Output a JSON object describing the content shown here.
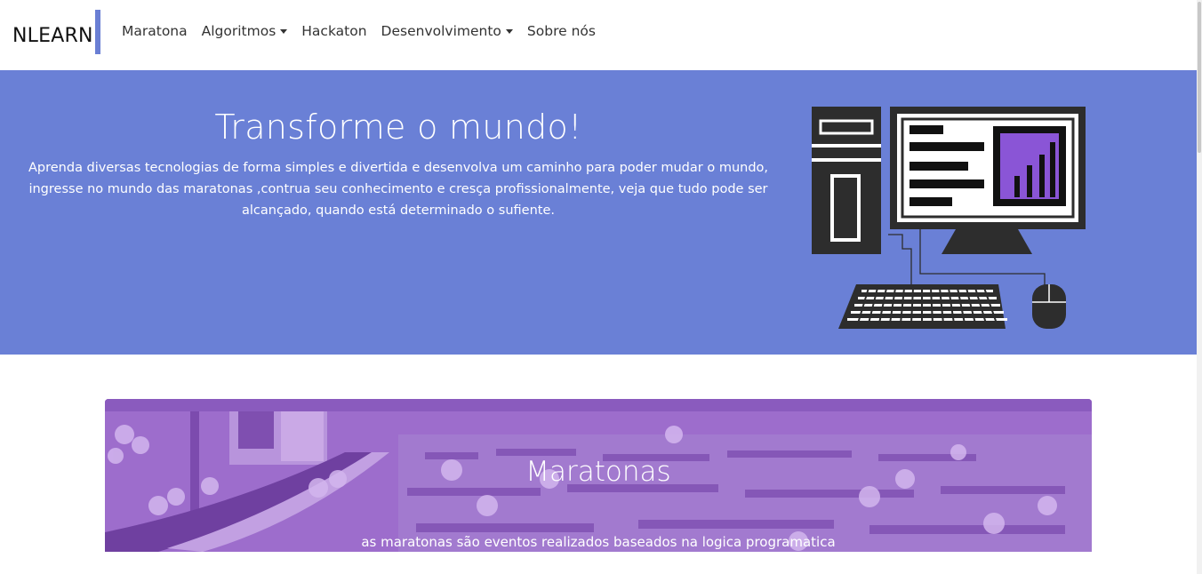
{
  "navbar": {
    "brand": "NLEARN",
    "items": [
      {
        "label": "Maratona",
        "dropdown": false
      },
      {
        "label": "Algoritmos",
        "dropdown": true
      },
      {
        "label": "Hackaton",
        "dropdown": false
      },
      {
        "label": "Desenvolvimento",
        "dropdown": true
      },
      {
        "label": "Sobre nós",
        "dropdown": false
      }
    ]
  },
  "hero": {
    "title": "Transforme o mundo!",
    "text": "Aprenda diversas tecnologias de forma simples e divertida e desenvolva um caminho para poder mudar o mundo, ingresse no mundo das maratonas ,contrua seu conhecimento e cresça profissionalmente, veja que tudo pode ser alcançado, quando está determinado o sufiente.",
    "illustration": "desktop-computer-illustration",
    "background_color": "#6a80d6",
    "accent_color": "#8a55d6"
  },
  "card": {
    "title": "Maratonas",
    "text": "as maratonas são eventos realizados baseados na logica programatica",
    "overlay_color": "#9a68c9"
  }
}
